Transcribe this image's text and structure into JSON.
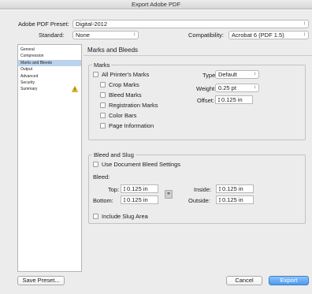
{
  "window": {
    "title": "Export Adobe PDF"
  },
  "preset": {
    "label": "Adobe PDF Preset:",
    "value": "Digital-2012"
  },
  "standard": {
    "label": "Standard:",
    "value": "None"
  },
  "compatibility": {
    "label": "Compatibility:",
    "value": "Acrobat 6 (PDF 1.5)"
  },
  "sidebar": {
    "items": [
      {
        "label": "General"
      },
      {
        "label": "Compression"
      },
      {
        "label": "Marks and Bleeds"
      },
      {
        "label": "Output"
      },
      {
        "label": "Advanced"
      },
      {
        "label": "Security"
      },
      {
        "label": "Summary"
      }
    ],
    "selected_index": 2,
    "warning_item": "Summary"
  },
  "main": {
    "title": "Marks and Bleeds",
    "marks": {
      "title": "Marks",
      "all_printers": "All Printer's Marks",
      "crop": "Crop Marks",
      "bleed": "Bleed Marks",
      "registration": "Registration Marks",
      "color_bars": "Color Bars",
      "page_info": "Page Information",
      "type_label": "Type:",
      "type_value": "Default",
      "weight_label": "Weight:",
      "weight_value": "0.25 pt",
      "offset_label": "Offset:",
      "offset_value": "0.125 in"
    },
    "bleed_slug": {
      "title": "Bleed and Slug",
      "use_doc": "Use Document Bleed Settings",
      "bleed_label": "Bleed:",
      "top_label": "Top:",
      "top_value": "0.125 in",
      "bottom_label": "Bottom:",
      "bottom_value": "0.125 in",
      "inside_label": "Inside:",
      "inside_value": "0.125 in",
      "outside_label": "Outside:",
      "outside_value": "0.125 in",
      "slug": "Include Slug Area"
    }
  },
  "buttons": {
    "save_preset": "Save Preset...",
    "cancel": "Cancel",
    "export": "Export"
  },
  "colors": {
    "selection": "#bcd3ef",
    "primary": "#4a9bf2",
    "warning": "#f2c200"
  }
}
